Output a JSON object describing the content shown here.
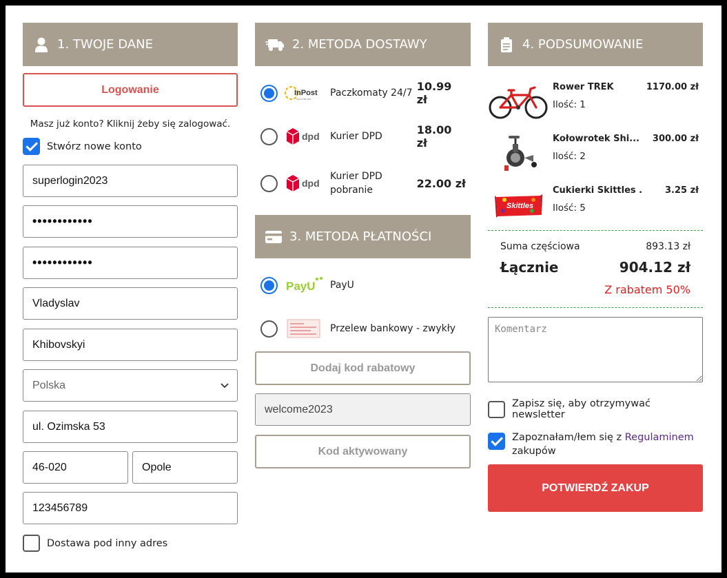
{
  "col1": {
    "header": "1. TWOJE DANE",
    "login_button": "Logowanie",
    "login_hint": "Masz już konto? Kliknij żeby się zalogować.",
    "create_account": {
      "label": "Stwórz nowe konto",
      "checked": true
    },
    "username": "superlogin2023",
    "password": "••••••••••••",
    "password_confirm": "••••••••••••",
    "first_name": "Vladyslav",
    "last_name": "Khibovskyi",
    "country": "Polska",
    "street": "ul. Ozimska 53",
    "postal_code": "46-020",
    "city": "Opole",
    "phone": "123456789",
    "other_address": {
      "label": "Dostawa pod inny adres",
      "checked": false
    }
  },
  "col2": {
    "shipping_header": "2. METODA DOSTAWY",
    "shipping": [
      {
        "name": "Paczkomaty 24/7",
        "price": "10.99 zł",
        "logo": "inpost-logo",
        "selected": true
      },
      {
        "name": "Kurier DPD",
        "price": "18.00 zł",
        "logo": "dpd-logo",
        "selected": false
      },
      {
        "name": "Kurier DPD pobranie",
        "price": "22.00 zł",
        "logo": "dpd-logo",
        "selected": false
      }
    ],
    "payment_header": "3. METODA PŁATNOŚCI",
    "payment": [
      {
        "name": "PayU",
        "logo": "payu-logo",
        "selected": true
      },
      {
        "name": "Przelew bankowy - zwykły",
        "logo": "bank-transfer-icon",
        "selected": false
      }
    ],
    "add_discount_button": "Dodaj kod rabatowy",
    "discount_code": "welcome2023",
    "code_activated_button": "Kod aktywowany"
  },
  "col3": {
    "header": "4. PODSUMOWANIE",
    "items": [
      {
        "name": "Rower TREK",
        "qty": "Ilość: 1",
        "price": "1170.00 zł",
        "image": "bicycle-image"
      },
      {
        "name": "Kołowrotek Shi...",
        "qty": "Ilość: 2",
        "price": "300.00 zł",
        "image": "fishing-reel-image"
      },
      {
        "name": "Cukierki Skittles ...",
        "qty": "Ilość: 5",
        "price": "3.25 zł",
        "image": "skittles-image"
      }
    ],
    "subtotal_label": "Suma częściowa",
    "subtotal_value": "893.13 zł",
    "total_label": "Łącznie",
    "total_value": "904.12 zł",
    "discount_note": "Z rabatem 50%",
    "comment_placeholder": "Komentarz",
    "newsletter": {
      "label": "Zapisz się, aby otrzymywać newsletter",
      "checked": false
    },
    "terms": {
      "prefix": "Zapoznałam/łem się z ",
      "link": "Regulaminem",
      "suffix": "zakupów",
      "checked": true
    },
    "confirm_button": "POTWIERDŹ ZAKUP"
  },
  "colors": {
    "header_bg": "#a89f90",
    "accent_red": "#e24444",
    "checkbox_blue": "#1a73e8",
    "divider_green": "#3aa04a",
    "link_purple": "#5a2a82"
  }
}
